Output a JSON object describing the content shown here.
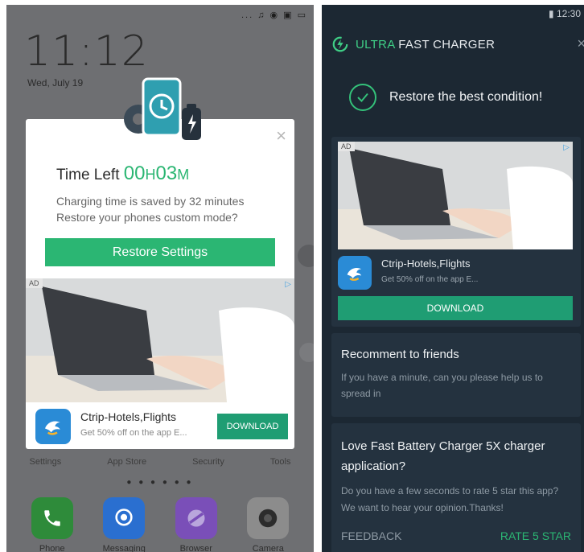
{
  "left": {
    "status_icons": "... ♫ ◉ ▣ ▭",
    "lock_time": "11:12",
    "lock_date": "Wed, July 19",
    "popup": {
      "close_label": "×",
      "time_left_label": "Time Left",
      "time_hours_value": "00",
      "time_hours_unit": "H",
      "time_minutes_value": "03",
      "time_minutes_unit": "M",
      "desc_line1": "Charging time is saved by 32 minutes",
      "desc_line2": "Restore your phones custom mode?",
      "restore_button": "Restore Settings",
      "ad_tag": "AD",
      "ad_title": "Ctrip-Hotels,Flights",
      "ad_subtitle": "Get 50% off on the app E...",
      "download_button": "DOWNLOAD"
    },
    "home_labels": [
      "Settings",
      "App Store",
      "Security",
      "Tools"
    ],
    "page_dots": "● ● ● ● ● ●",
    "dock": [
      {
        "label": "Phone",
        "color": "#2e8b3a"
      },
      {
        "label": "Messaging",
        "color": "#2a6fd0"
      },
      {
        "label": "Browser",
        "color": "#7a4fb8"
      },
      {
        "label": "Camera",
        "color": "#8c8c8c"
      }
    ]
  },
  "right": {
    "status_time": "12:30",
    "header": {
      "title_highlight": "ULTRA",
      "title_rest": "FAST CHARGER",
      "close_label": "×"
    },
    "restore_message": "Restore the best condition!",
    "ad": {
      "tag": "AD",
      "title": "Ctrip-Hotels,Flights",
      "subtitle": "Get 50% off on the app E...",
      "download_button": "DOWNLOAD"
    },
    "recommend": {
      "title": "Recomment to friends",
      "text": "If you have a minute, can you please help us to spread in"
    },
    "rate": {
      "title": "Love Fast Battery Charger 5X charger application?",
      "text": "Do you have a few seconds to rate 5 star this app? We want to hear your opinion.Thanks!",
      "feedback_button": "FEEDBACK",
      "rate_button": "RATE 5 STAR"
    }
  },
  "colors": {
    "accent_green": "#2bb673",
    "download_green": "#1f9d73",
    "dark_bg": "#1c2833",
    "card_bg": "#24323f"
  }
}
